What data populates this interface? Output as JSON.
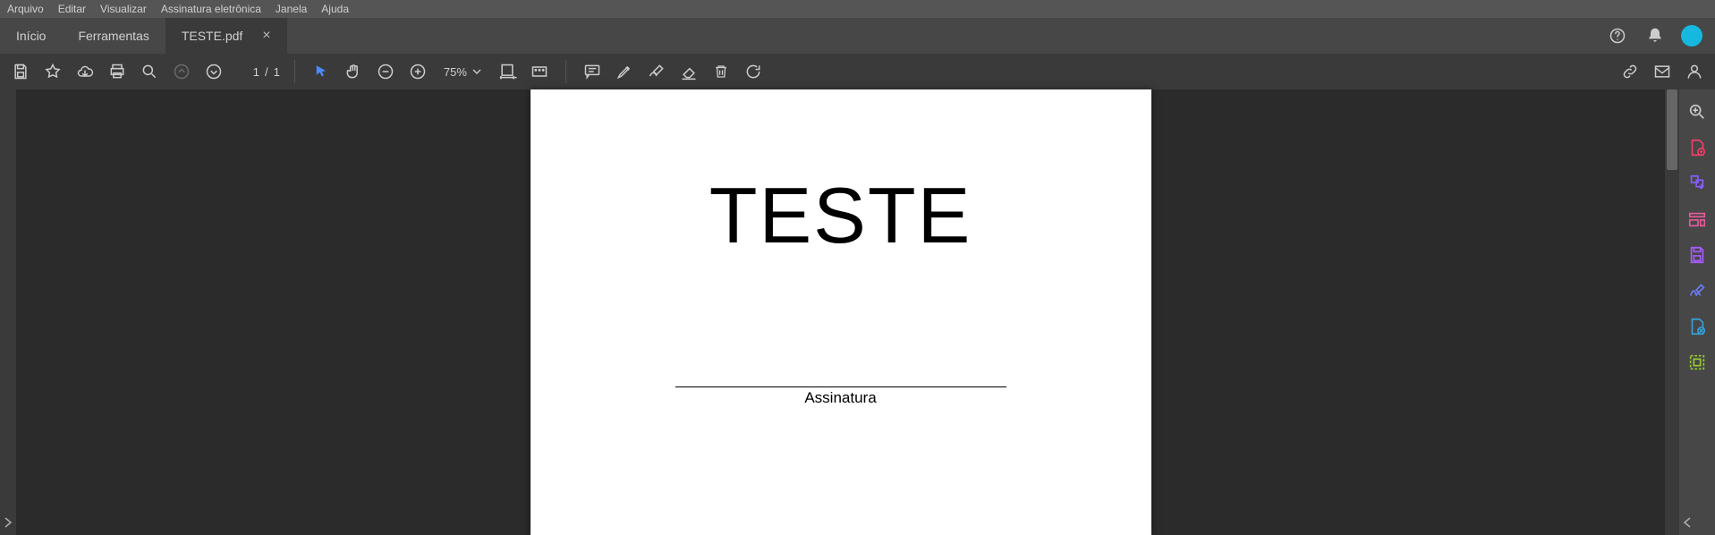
{
  "menubar": [
    "Arquivo",
    "Editar",
    "Visualizar",
    "Assinatura eletrônica",
    "Janela",
    "Ajuda"
  ],
  "tabs": {
    "home": "Início",
    "tools": "Ferramentas",
    "file": "TESTE.pdf"
  },
  "page": {
    "current": "1",
    "sep": "/",
    "total": "1"
  },
  "zoom": "75%",
  "document": {
    "heading": "TESTE",
    "signature_label": "Assinatura"
  }
}
